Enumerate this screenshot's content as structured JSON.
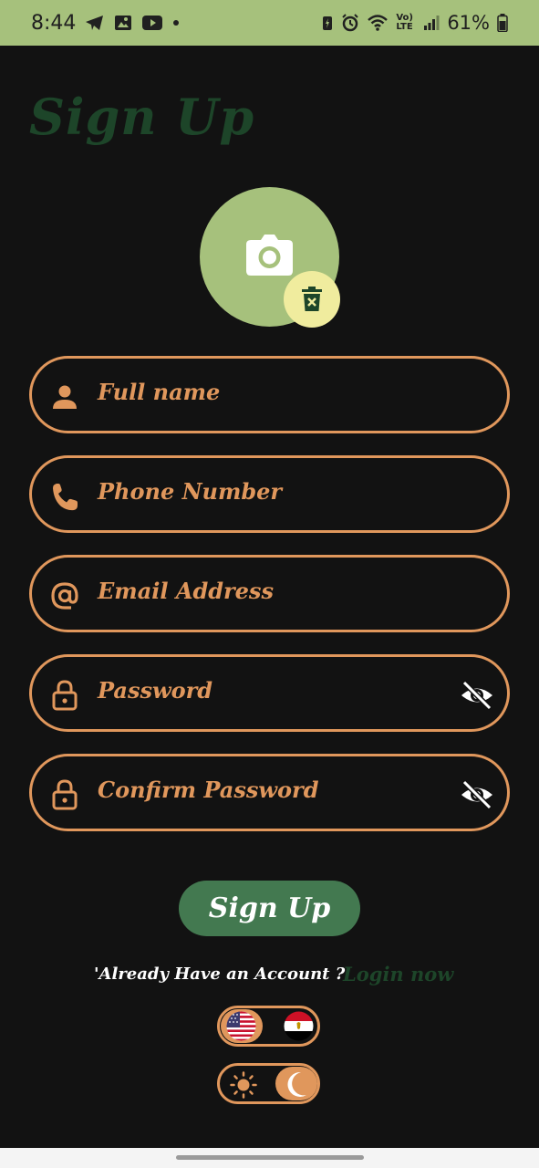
{
  "status_bar": {
    "time": "8:44",
    "battery": "61%",
    "network": "Vo) LTE"
  },
  "title": "Sign Up",
  "fields": [
    {
      "placeholder": "Full name",
      "icon": "person-icon"
    },
    {
      "placeholder": "Phone Number",
      "icon": "phone-icon"
    },
    {
      "placeholder": "Email Address",
      "icon": "at-icon"
    },
    {
      "placeholder": "Password",
      "icon": "lock-icon",
      "toggle": "eye-off-icon"
    },
    {
      "placeholder": "Confirm Password",
      "icon": "lock-icon",
      "toggle": "eye-off-icon"
    }
  ],
  "signup_button": "Sign Up",
  "have_account": "'Already Have an Account ?",
  "login_link": "Login now",
  "language_toggle": {
    "selected": "English (US)",
    "options": [
      "English (US)",
      "Arabic (Egypt)"
    ]
  },
  "theme_toggle": {
    "selected": "dark",
    "options": [
      "light",
      "dark"
    ]
  },
  "colors": {
    "accent": "#e0975c",
    "primary_green": "#437950",
    "dark_green": "#1d4529",
    "status_bar": "#a6c17c",
    "avatar_bg": "#a6c17c",
    "delete_badge": "#f0ec9e",
    "background": "#121212"
  }
}
